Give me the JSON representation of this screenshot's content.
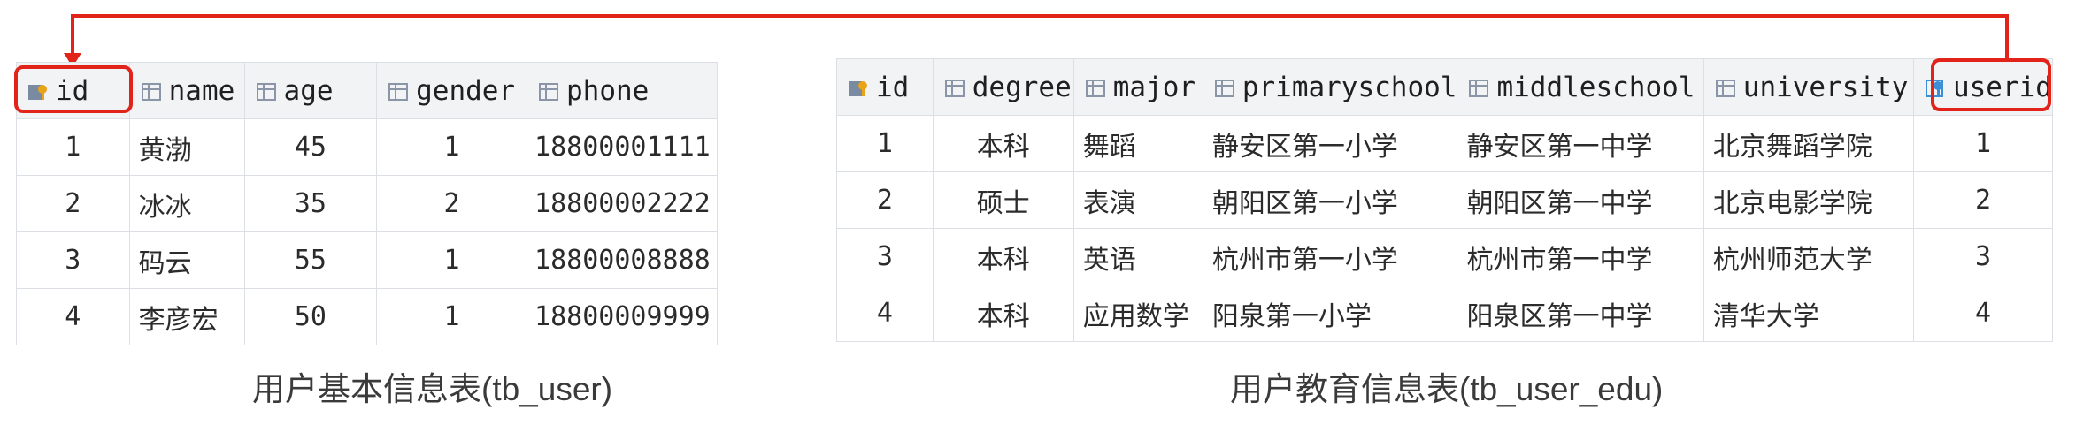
{
  "user_table": {
    "caption": "用户基本信息表(tb_user)",
    "columns": [
      {
        "label": "id",
        "icon": "primary-key-icon"
      },
      {
        "label": "name",
        "icon": "column-icon"
      },
      {
        "label": "age",
        "icon": "column-icon"
      },
      {
        "label": "gender",
        "icon": "column-icon"
      },
      {
        "label": "phone",
        "icon": "column-icon"
      }
    ],
    "rows": [
      [
        "1",
        "黄渤",
        "45",
        "1",
        "18800001111"
      ],
      [
        "2",
        "冰冰",
        "35",
        "2",
        "18800002222"
      ],
      [
        "3",
        "码云",
        "55",
        "1",
        "18800008888"
      ],
      [
        "4",
        "李彦宏",
        "50",
        "1",
        "18800009999"
      ]
    ]
  },
  "edu_table": {
    "caption": "用户教育信息表(tb_user_edu)",
    "columns": [
      {
        "label": "id",
        "icon": "primary-key-icon"
      },
      {
        "label": "degree",
        "icon": "column-icon"
      },
      {
        "label": "major",
        "icon": "column-icon"
      },
      {
        "label": "primaryschool",
        "icon": "column-icon"
      },
      {
        "label": "middleschool",
        "icon": "column-icon"
      },
      {
        "label": "university",
        "icon": "column-icon"
      },
      {
        "label": "userid",
        "icon": "foreign-key-icon"
      }
    ],
    "rows": [
      [
        "1",
        "本科",
        "舞蹈",
        "静安区第一小学",
        "静安区第一中学",
        "北京舞蹈学院",
        "1"
      ],
      [
        "2",
        "硕士",
        "表演",
        "朝阳区第一小学",
        "朝阳区第一中学",
        "北京电影学院",
        "2"
      ],
      [
        "3",
        "本科",
        "英语",
        "杭州市第一小学",
        "杭州市第一中学",
        "杭州师范大学",
        "3"
      ],
      [
        "4",
        "本科",
        "应用数学",
        "阳泉第一小学",
        "阳泉区第一中学",
        "清华大学",
        "4"
      ]
    ]
  },
  "colors": {
    "highlight": "#e2231a",
    "header_bg": "#f2f3f5",
    "grid": "#dcdfe4"
  }
}
